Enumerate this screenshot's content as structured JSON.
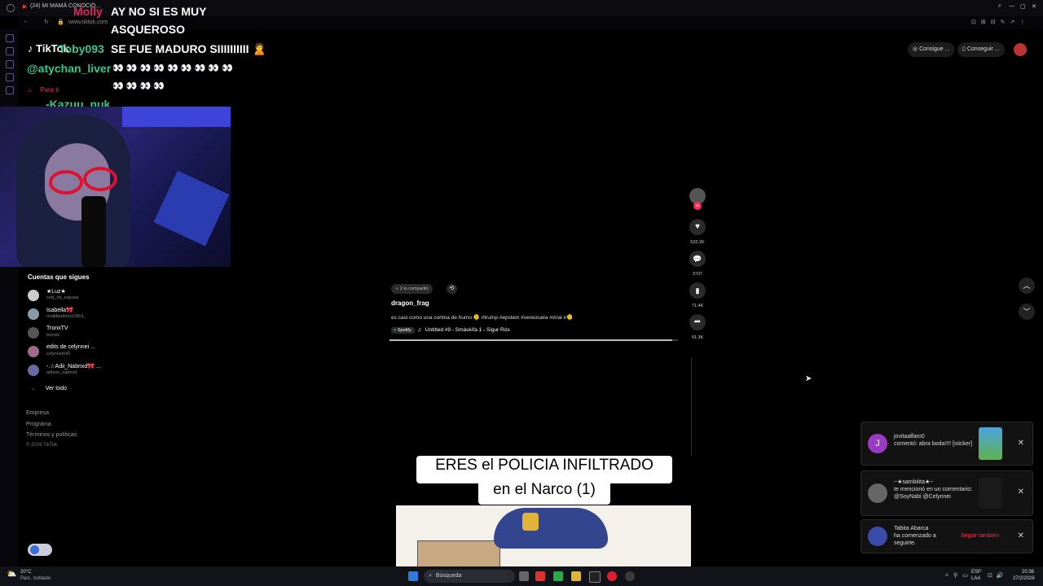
{
  "browser": {
    "tab_title": "(24) MI MAMÁ CONOCIÓ...",
    "url": "www.tiktok.com"
  },
  "stream_chat": {
    "lines": [
      {
        "user": "Molly",
        "text": "AY NO SI ES MUY"
      },
      {
        "user": "",
        "text": "ASQUEROSO"
      },
      {
        "user": "Toby093",
        "text": "SE FUE MADURO SIIIIIIIIII 🙎"
      },
      {
        "user": "@atychan_liver",
        "text": "👀 👀 👀 👀 👀 👀 👀 👀 👀"
      },
      {
        "user": "",
        "text": "👀 👀 👀 👀"
      },
      {
        "user": "-Kazuu_nuk",
        "text": ""
      }
    ]
  },
  "sidebar": {
    "logo": "TikTok",
    "nav_item": "Para ti",
    "following_header": "Cuentas que sigues",
    "accounts": [
      {
        "name": "★Luz★",
        "handle": "cely_mi_esposa"
      },
      {
        "name": "Isabella🎀",
        "handle": "multifandom12453_"
      },
      {
        "name": "TronxTV",
        "handle": "tronxtv"
      },
      {
        "name": "edits de celynnei ...",
        "handle": "celynnei042"
      },
      {
        "name": "-.☆Adii_Nabrixd🎀 ...",
        "handle": "adison_nabrixd"
      }
    ],
    "see_all": "Ver todo",
    "footer": [
      "Empresa",
      "Programa",
      "Términos y políticas",
      "© 2026 TikTok"
    ]
  },
  "header_buttons": {
    "get_coins": "Consigue ...",
    "get_app": "Conseguir ..."
  },
  "video": {
    "shared_label": "2 lo compartió",
    "author": "dragon_frag",
    "caption": "es casi como una cortina de humo 🫠 #trump #epstein #venezuela #viral #🫠",
    "music_source": "Spotify",
    "music": "Untitled #9 - Smáskífa 1 - Sigur Rós",
    "next_title_line1": "ERES el POLICIA INFILTRADO",
    "next_title_line2": "en el Narco (1)"
  },
  "actions": {
    "likes": "502.2K",
    "comments": "3707",
    "saves": "71.4K",
    "shares": "91.3K"
  },
  "notifications": [
    {
      "user": "jovitaalfaro0",
      "text": "comentó: abra boda!!!! [sticker]",
      "color": "#9b3bc5"
    },
    {
      "user": "~★sambiiita★~",
      "text": "te mencionó en un comentario: @SoyNabi @Celynnei",
      "color": "#555"
    },
    {
      "user": "Tabita Abarca",
      "text": "ha comenzado a seguirte.",
      "button": "Seguir también",
      "color": "#3b4ba8"
    }
  ],
  "taskbar": {
    "weather_temp": "20°C",
    "weather_desc": "Parc. nublado",
    "search": "Búsqueda",
    "lang": "ESP",
    "lang2": "LAA",
    "time": "20:36",
    "date": "27/2/2026"
  },
  "colors": {
    "accent": "#fe2c55",
    "chat_name": "#34c98e"
  }
}
